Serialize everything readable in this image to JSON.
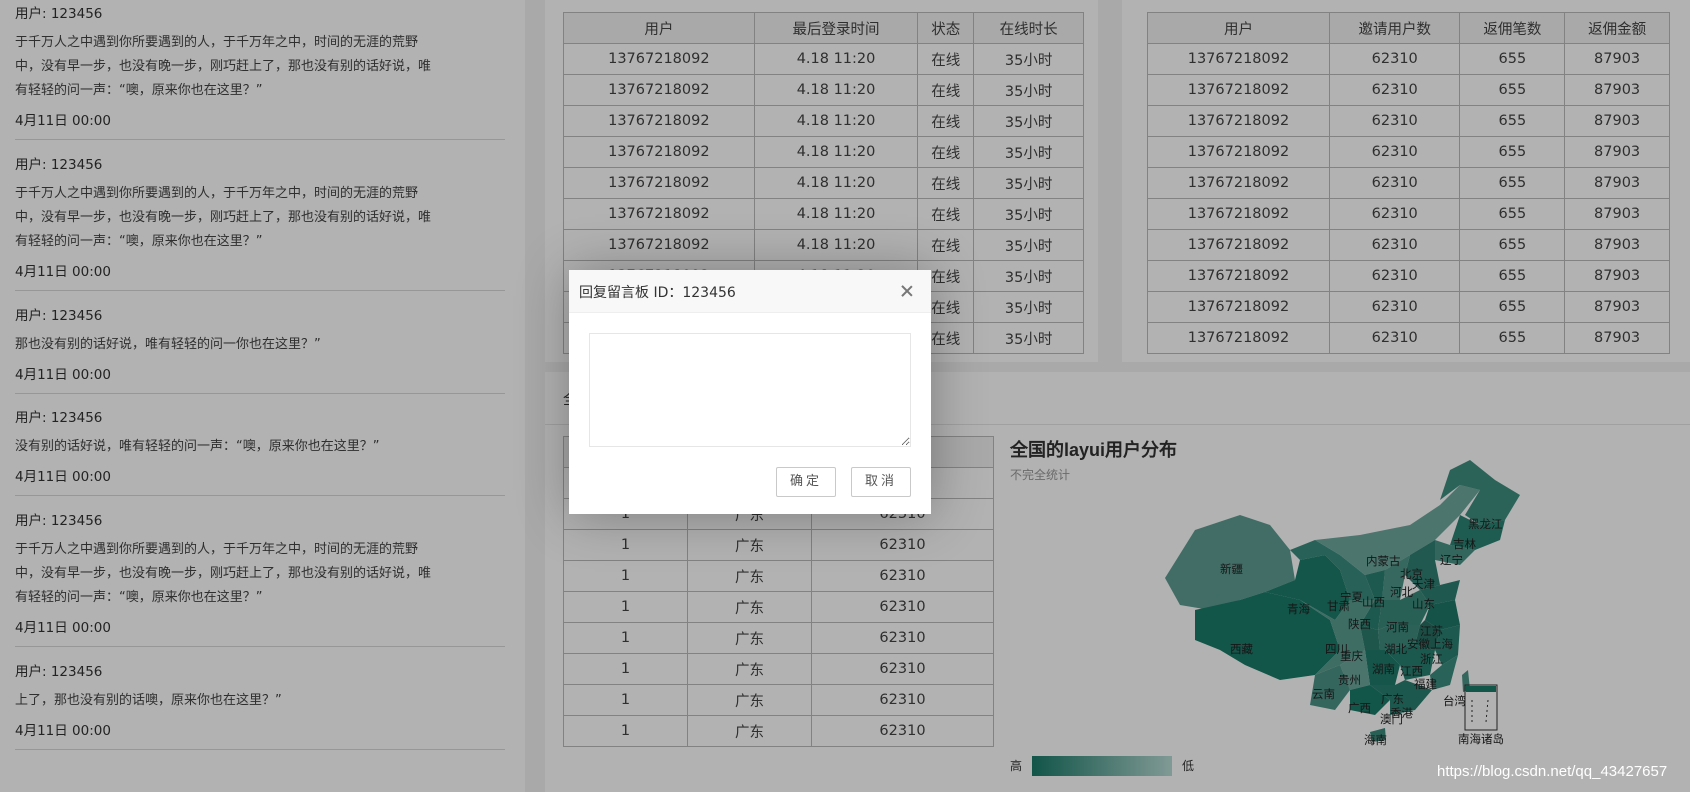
{
  "messages": [
    {
      "user": "用户: 123456",
      "text": [
        "于千万人之中遇到你所要遇到的人，于千万年之中，时间的无涯的荒野",
        "中，没有早一步，也没有晚一步，刚巧赶上了，那也没有别的话好说，唯",
        "有轻轻的问一声：“噢，原来你也在这里？”"
      ],
      "time": "4月11日 00:00"
    },
    {
      "user": "用户: 123456",
      "text": [
        "于千万人之中遇到你所要遇到的人，于千万年之中，时间的无涯的荒野",
        "中，没有早一步，也没有晚一步，刚巧赶上了，那也没有别的话好说，唯",
        "有轻轻的问一声：“噢，原来你也在这里？”"
      ],
      "time": "4月11日 00:00"
    },
    {
      "user": "用户: 123456",
      "text": [
        "那也没有别的话好说，唯有轻轻的问一你也在这里？”"
      ],
      "time": "4月11日 00:00"
    },
    {
      "user": "用户: 123456",
      "text": [
        "没有别的话好说，唯有轻轻的问一声：“噢，原来你也在这里？”"
      ],
      "time": "4月11日 00:00"
    },
    {
      "user": "用户: 123456",
      "text": [
        "于千万人之中遇到你所要遇到的人，于千万年之中，时间的无涯的荒野",
        "中，没有早一步，也没有晚一步，刚巧赶上了，那也没有别的话好说，唯",
        "有轻轻的问一声：“噢，原来你也在这里？”"
      ],
      "time": "4月11日 00:00"
    },
    {
      "user": "用户: 123456",
      "text": [
        "上了，那也没有别的话噢，原来你也在这里？”"
      ],
      "time": "4月11日 00:00"
    }
  ],
  "online_table": {
    "headers": [
      "用户",
      "最后登录时间",
      "状态",
      "在线时长"
    ],
    "rows": [
      [
        "13767218092",
        "4.18 11:20",
        "在线",
        "35小时"
      ],
      [
        "13767218092",
        "4.18 11:20",
        "在线",
        "35小时"
      ],
      [
        "13767218092",
        "4.18 11:20",
        "在线",
        "35小时"
      ],
      [
        "13767218092",
        "4.18 11:20",
        "在线",
        "35小时"
      ],
      [
        "13767218092",
        "4.18 11:20",
        "在线",
        "35小时"
      ],
      [
        "13767218092",
        "4.18 11:20",
        "在线",
        "35小时"
      ],
      [
        "13767218092",
        "4.18 11:20",
        "在线",
        "35小时"
      ],
      [
        "13767218092",
        "4.18 11:20",
        "在线",
        "35小时"
      ],
      [
        "13767218092",
        "4.18 11:20",
        "在线",
        "35小时"
      ],
      [
        "13767218092",
        "4.18 11:20",
        "在线",
        "35小时"
      ]
    ]
  },
  "invite_table": {
    "headers": [
      "用户",
      "邀请用户数",
      "返佣笔数",
      "返佣金额"
    ],
    "rows": [
      [
        "13767218092",
        "62310",
        "655",
        "87903"
      ],
      [
        "13767218092",
        "62310",
        "655",
        "87903"
      ],
      [
        "13767218092",
        "62310",
        "655",
        "87903"
      ],
      [
        "13767218092",
        "62310",
        "655",
        "87903"
      ],
      [
        "13767218092",
        "62310",
        "655",
        "87903"
      ],
      [
        "13767218092",
        "62310",
        "655",
        "87903"
      ],
      [
        "13767218092",
        "62310",
        "655",
        "87903"
      ],
      [
        "13767218092",
        "62310",
        "655",
        "87903"
      ],
      [
        "13767218092",
        "62310",
        "655",
        "87903"
      ],
      [
        "13767218092",
        "62310",
        "655",
        "87903"
      ]
    ]
  },
  "region_section": {
    "title_initial": "全",
    "rows": [
      [
        "1",
        "广东",
        "62310"
      ],
      [
        "1",
        "广东",
        "62310"
      ],
      [
        "1",
        "广东",
        "62310"
      ],
      [
        "1",
        "广东",
        "62310"
      ],
      [
        "1",
        "广东",
        "62310"
      ],
      [
        "1",
        "广东",
        "62310"
      ],
      [
        "1",
        "广东",
        "62310"
      ],
      [
        "1",
        "广东",
        "62310"
      ],
      [
        "1",
        "广东",
        "62310"
      ]
    ]
  },
  "map": {
    "title": "全国的layui用户分布",
    "subtitle": "不完全统计",
    "legend_high": "高",
    "legend_low": "低",
    "colors": {
      "high": "#1a7a69",
      "low": "#b9dcd5"
    },
    "provinces": [
      "黑龙江",
      "吉林",
      "辽宁",
      "内蒙古",
      "北京",
      "天津",
      "河北",
      "山东",
      "新疆",
      "青海",
      "甘肃",
      "宁夏",
      "山西",
      "河南",
      "江苏",
      "陕西",
      "安徽",
      "上海",
      "西藏",
      "四川",
      "重庆",
      "湖北",
      "浙江",
      "湖南",
      "江西",
      "贵州",
      "福建",
      "云南",
      "广西",
      "广东",
      "台湾",
      "香港",
      "澳门",
      "海南",
      "南海诸岛"
    ]
  },
  "dialog": {
    "title": "回复留言板 ID：123456",
    "textarea_value": "",
    "ok_label": "确定",
    "cancel_label": "取消"
  },
  "watermark": "https://blog.csdn.net/qq_43427657"
}
